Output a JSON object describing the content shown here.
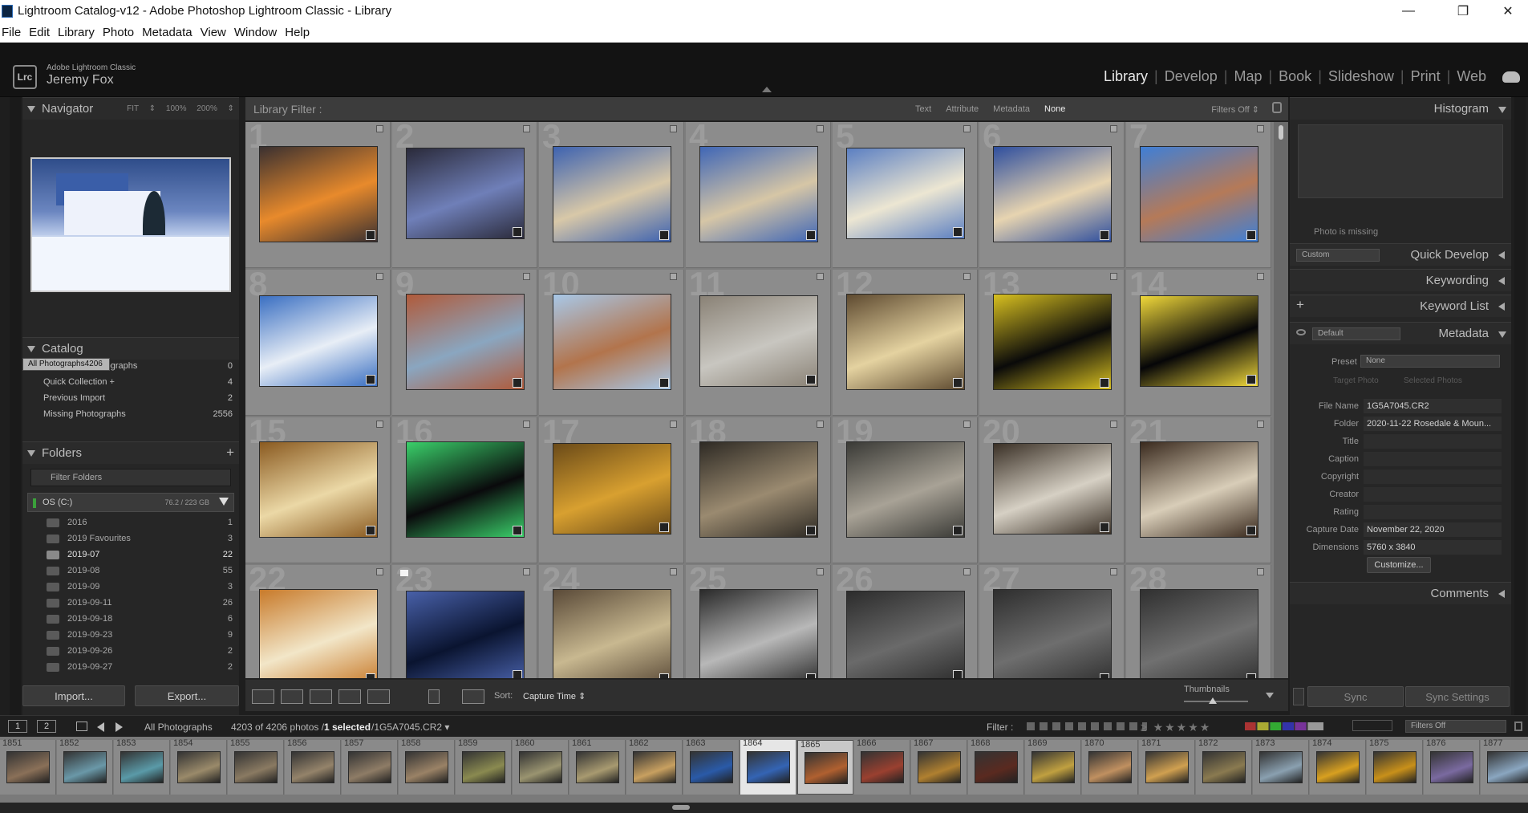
{
  "window": {
    "title": "Lightroom Catalog-v12 - Adobe Photoshop Lightroom Classic - Library",
    "minimize": "—",
    "restore": "❐",
    "close": "✕"
  },
  "menu": [
    "File",
    "Edit",
    "Library",
    "Photo",
    "Metadata",
    "View",
    "Window",
    "Help"
  ],
  "identity": {
    "logo": "Lrc",
    "product": "Adobe Lightroom Classic",
    "user": "Jeremy Fox"
  },
  "modules": [
    {
      "label": "Library",
      "active": true
    },
    {
      "label": "Develop",
      "active": false
    },
    {
      "label": "Map",
      "active": false
    },
    {
      "label": "Book",
      "active": false
    },
    {
      "label": "Slideshow",
      "active": false
    },
    {
      "label": "Print",
      "active": false
    },
    {
      "label": "Web",
      "active": false
    }
  ],
  "navigator": {
    "title": "Navigator",
    "zoom": [
      "FIT ⇕",
      "100%",
      "200% ⇕"
    ]
  },
  "catalog": {
    "title": "Catalog",
    "items": [
      {
        "label": "All Photographs",
        "count": "4206",
        "selected": true
      },
      {
        "label": "All Synced Photographs",
        "count": "0",
        "selected": false
      },
      {
        "label": "Quick Collection +",
        "count": "4",
        "selected": false
      },
      {
        "label": "Previous Import",
        "count": "2",
        "selected": false
      },
      {
        "label": "Missing Photographs",
        "count": "2556",
        "selected": false
      }
    ]
  },
  "folders": {
    "title": "Folders",
    "add": "+",
    "filter_placeholder": "Filter Folders",
    "volume": {
      "name": "OS (C:)",
      "size": "76.2 / 223 GB"
    },
    "items": [
      {
        "label": "2016",
        "count": "1",
        "hi": false
      },
      {
        "label": "2019 Favourites",
        "count": "3",
        "hi": false
      },
      {
        "label": "2019-07",
        "count": "22",
        "hi": true
      },
      {
        "label": "2019-08",
        "count": "55",
        "hi": false
      },
      {
        "label": "2019-09",
        "count": "3",
        "hi": false
      },
      {
        "label": "2019-09-11",
        "count": "26",
        "hi": false
      },
      {
        "label": "2019-09-18",
        "count": "6",
        "hi": false
      },
      {
        "label": "2019-09-23",
        "count": "9",
        "hi": false
      },
      {
        "label": "2019-09-26",
        "count": "2",
        "hi": false
      },
      {
        "label": "2019-09-27",
        "count": "2",
        "hi": false
      }
    ]
  },
  "buttons": {
    "import": "Import...",
    "export": "Export..."
  },
  "library_filter": {
    "label": "Library Filter :",
    "options": [
      "Text",
      "Attribute",
      "Metadata",
      "None"
    ],
    "active": "None",
    "filters_off": "Filters Off ⇕"
  },
  "grid": {
    "cells": [
      {
        "n": "1",
        "c1": "#e88a2c",
        "c2": "#3a3030"
      },
      {
        "n": "2",
        "c1": "#6f7fb8",
        "c2": "#2a2a3a"
      },
      {
        "n": "3",
        "c1": "#d8c8a8",
        "c2": "#3d62b0"
      },
      {
        "n": "4",
        "c1": "#d6c6a6",
        "c2": "#3f66b6"
      },
      {
        "n": "5",
        "c1": "#ece6d2",
        "c2": "#5b7fc2"
      },
      {
        "n": "6",
        "c1": "#e7d4b0",
        "c2": "#2e4e9e"
      },
      {
        "n": "7",
        "c1": "#b57a58",
        "c2": "#3f7fd6"
      },
      {
        "n": "8",
        "c1": "#e8eef6",
        "c2": "#3a6fc2"
      },
      {
        "n": "9",
        "c1": "#8aa6c0",
        "c2": "#b05a3a"
      },
      {
        "n": "10",
        "c1": "#b2744c",
        "c2": "#a8c8e8"
      },
      {
        "n": "11",
        "c1": "#c8c6c0",
        "c2": "#8a8276"
      },
      {
        "n": "12",
        "c1": "#e4d2a0",
        "c2": "#5e4a30"
      },
      {
        "n": "13",
        "c1": "#0a0a0a",
        "c2": "#d8c020"
      },
      {
        "n": "14",
        "c1": "#060608",
        "c2": "#f0d83a"
      },
      {
        "n": "15",
        "c1": "#ebd8a6",
        "c2": "#8a5a20"
      },
      {
        "n": "16",
        "c1": "#0a0a0c",
        "c2": "#3ad06a"
      },
      {
        "n": "17",
        "c1": "#d8a030",
        "c2": "#6a4a18"
      },
      {
        "n": "18",
        "c1": "#9a8a70",
        "c2": "#2e2a24"
      },
      {
        "n": "19",
        "c1": "#a8a296",
        "c2": "#3a3a36"
      },
      {
        "n": "20",
        "c1": "#d6d0c4",
        "c2": "#3a3026"
      },
      {
        "n": "21",
        "c1": "#d8cdb8",
        "c2": "#3a2a1e"
      },
      {
        "n": "22",
        "c1": "#f2e6c8",
        "c2": "#c87a2a"
      },
      {
        "n": "23",
        "c1": "#0a1430",
        "c2": "#4860a8"
      },
      {
        "n": "24",
        "c1": "#c8b890",
        "c2": "#5a4a38"
      },
      {
        "n": "25",
        "c1": "#b8b8b8",
        "c2": "#2a2a2a"
      },
      {
        "n": "26",
        "c1": "#6a6a6a",
        "c2": "#2c2c2c"
      },
      {
        "n": "27",
        "c1": "#6e6e6e",
        "c2": "#2e2e2e"
      },
      {
        "n": "28",
        "c1": "#707070",
        "c2": "#303030"
      }
    ]
  },
  "toolbar": {
    "sort_label": "Sort:",
    "sort_value": "Capture Time ⇕",
    "thumbnails": "Thumbnails"
  },
  "right": {
    "histogram": "Histogram",
    "photo_missing": "Photo is missing",
    "quick_develop": "Quick Develop",
    "qd_preset": "Custom",
    "keywording": "Keywording",
    "keyword_list": "Keyword List",
    "metadata": "Metadata",
    "md_preset_default": "Default",
    "preset_label": "Preset",
    "preset_value": "None",
    "target_photo": "Target Photo",
    "selected_photos": "Selected Photos",
    "fields": [
      {
        "k": "File Name",
        "v": "1G5A7045.CR2"
      },
      {
        "k": "Folder",
        "v": "2020-11-22 Rosedale & Moun..."
      },
      {
        "k": "Title",
        "v": ""
      },
      {
        "k": "Caption",
        "v": ""
      },
      {
        "k": "Copyright",
        "v": ""
      },
      {
        "k": "Creator",
        "v": ""
      },
      {
        "k": "Rating",
        "v": ""
      },
      {
        "k": "Capture Date",
        "v": "November 22, 2020"
      },
      {
        "k": "Dimensions",
        "v": "5760 x 3840"
      }
    ],
    "customize": "Customize...",
    "comments": "Comments",
    "sync": "Sync",
    "sync_settings": "Sync Settings"
  },
  "filmstrip": {
    "screen1": "1",
    "screen2": "2",
    "source": "All Photographs",
    "count_prefix": "4203 of 4206 photos /",
    "count_selected": "1 selected",
    "count_file": "/1G5A7045.CR2 ▾",
    "filter_label": "Filter :",
    "filters_off": "Filters Off",
    "frames": [
      {
        "n": "1851",
        "c": "#8a7058"
      },
      {
        "n": "1852",
        "c": "#6a98a8"
      },
      {
        "n": "1853",
        "c": "#5a9aa8"
      },
      {
        "n": "1854",
        "c": "#9a8a6a"
      },
      {
        "n": "1855",
        "c": "#8a7a62"
      },
      {
        "n": "1856",
        "c": "#94836a"
      },
      {
        "n": "1857",
        "c": "#8e7c66"
      },
      {
        "n": "1858",
        "c": "#9a8266"
      },
      {
        "n": "1859",
        "c": "#8a8a50"
      },
      {
        "n": "1860",
        "c": "#9a9470"
      },
      {
        "n": "1861",
        "c": "#a89a70"
      },
      {
        "n": "1862",
        "c": "#c8a060"
      },
      {
        "n": "1863",
        "c": "#2a5aa8"
      },
      {
        "n": "1864",
        "c": "#3464b4"
      },
      {
        "n": "1865",
        "c": "#b06030"
      },
      {
        "n": "1866",
        "c": "#9a4030"
      },
      {
        "n": "1867",
        "c": "#b08030"
      },
      {
        "n": "1868",
        "c": "#5a2a20"
      },
      {
        "n": "1869",
        "c": "#c0a040"
      },
      {
        "n": "1870",
        "c": "#c09060"
      },
      {
        "n": "1871",
        "c": "#d0a050"
      },
      {
        "n": "1872",
        "c": "#8a7a50"
      },
      {
        "n": "1873",
        "c": "#8aa0b0"
      },
      {
        "n": "1874",
        "c": "#d8a020"
      },
      {
        "n": "1875",
        "c": "#c8901a"
      },
      {
        "n": "1876",
        "c": "#7a6aa0"
      },
      {
        "n": "1877",
        "c": "#8aa6c0"
      }
    ]
  }
}
